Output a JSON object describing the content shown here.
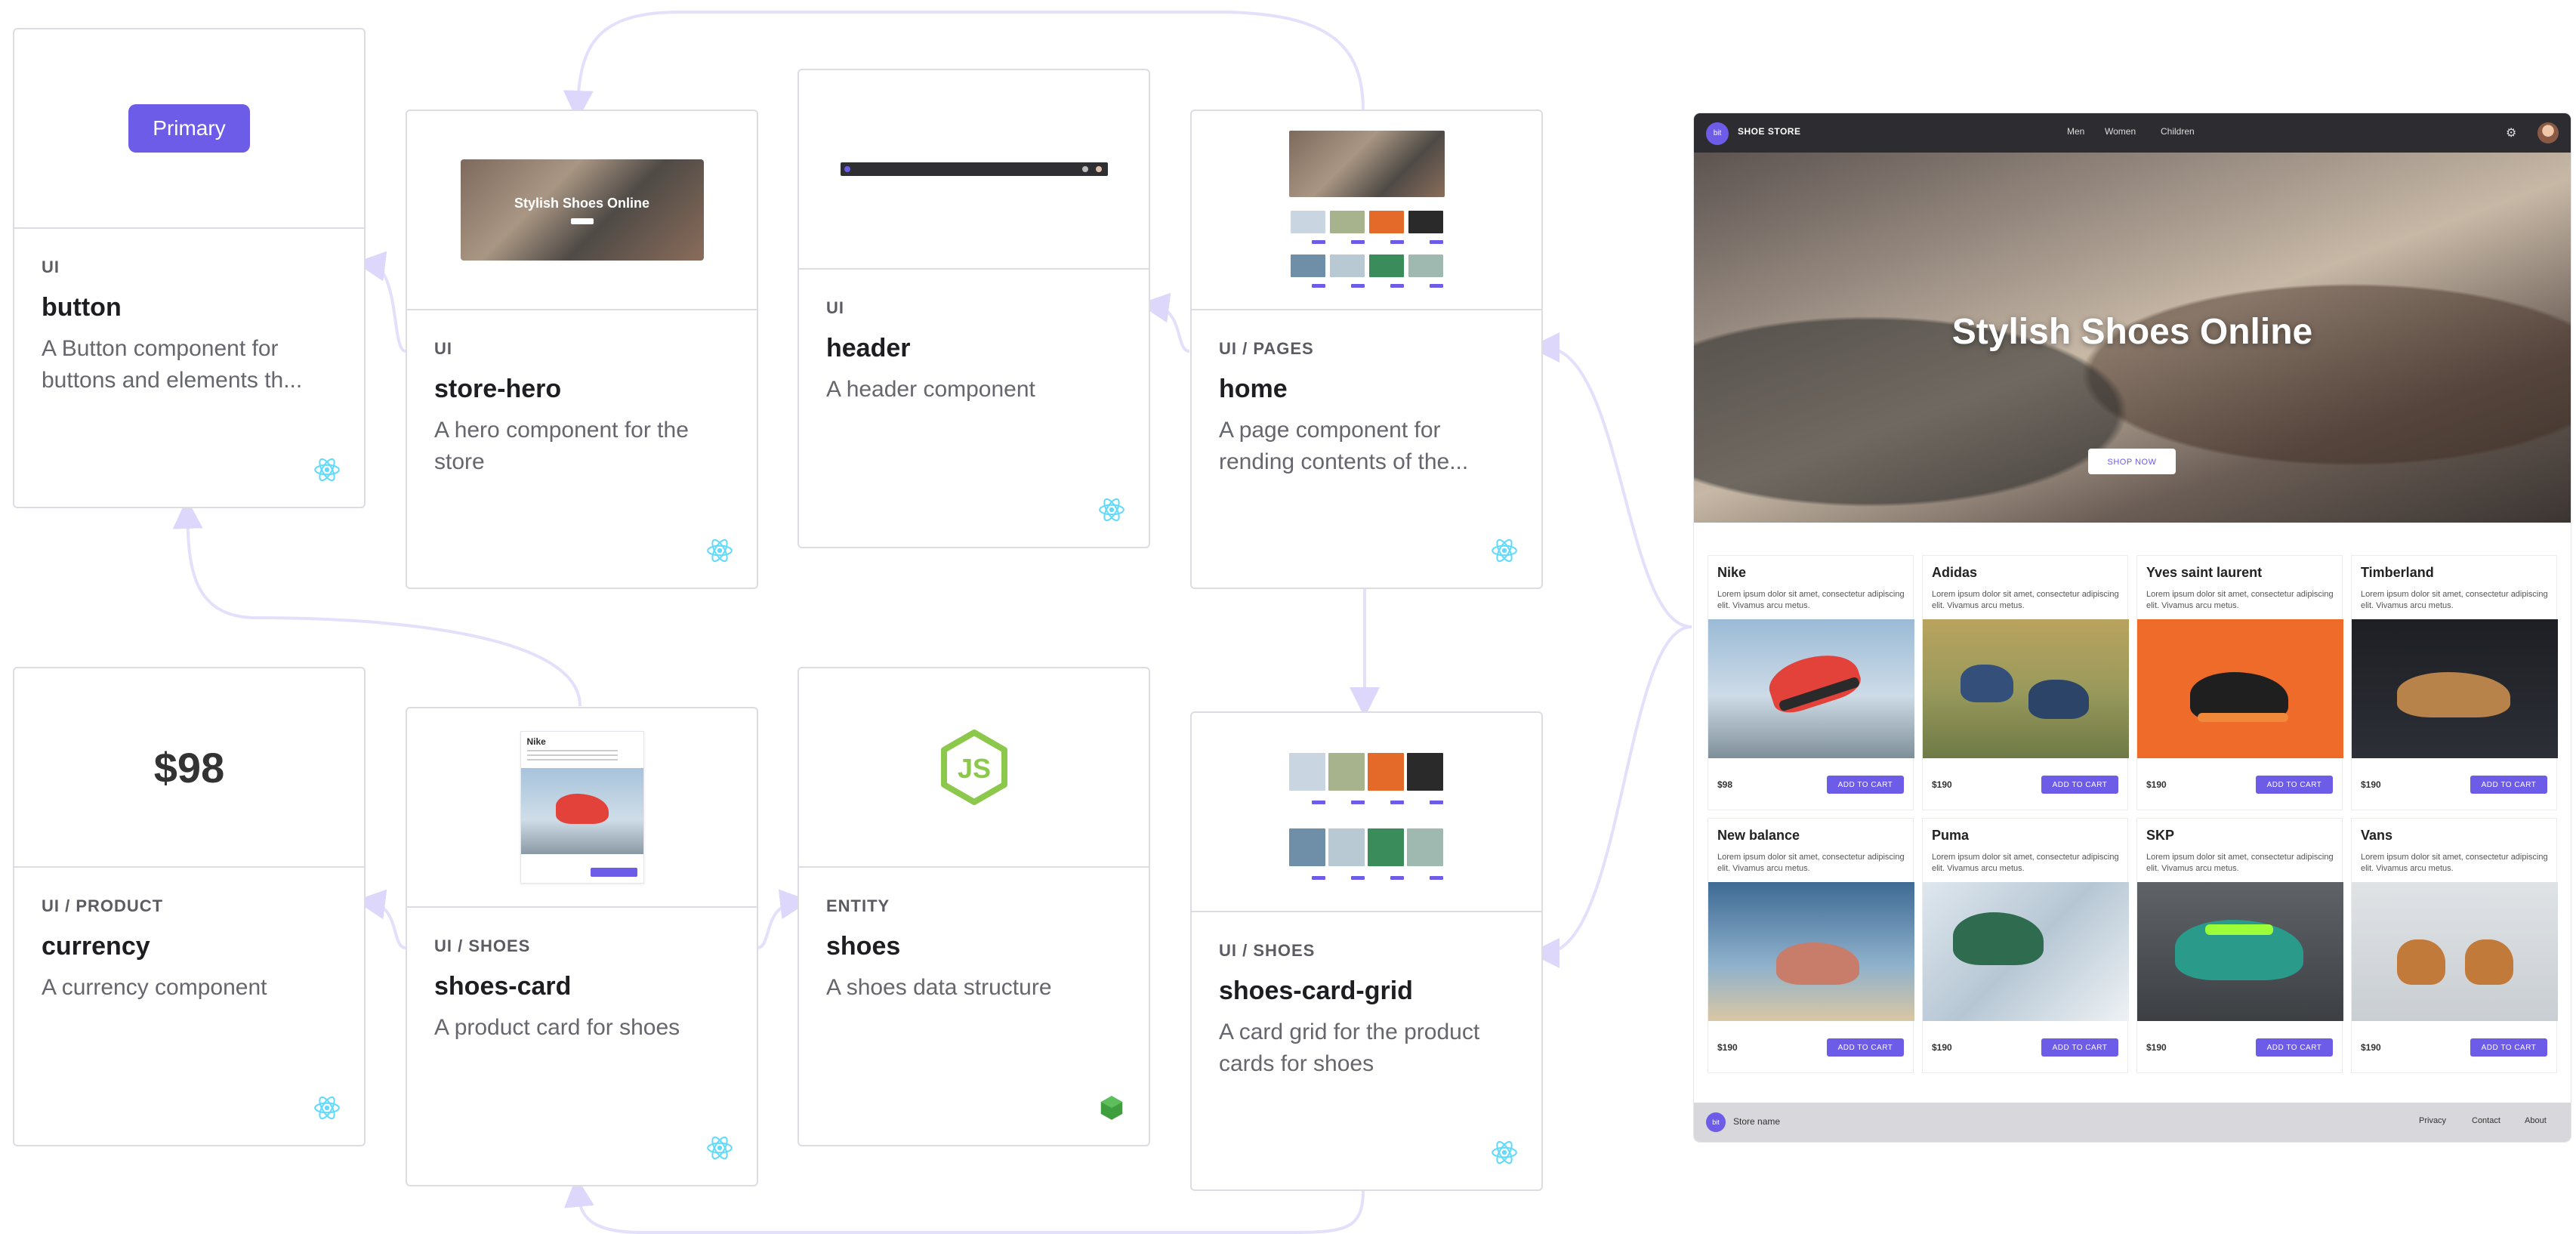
{
  "cards": {
    "button": {
      "category": "UI",
      "name": "button",
      "description": "A Button component for buttons and elements th...",
      "preview_label": "Primary"
    },
    "store_hero": {
      "category": "UI",
      "name": "store-hero",
      "description": "A hero component for the store",
      "preview_title": "Stylish Shoes Online"
    },
    "header": {
      "category": "UI",
      "name": "header",
      "description": "A header component"
    },
    "home": {
      "category": "UI / PAGES",
      "name": "home",
      "description": "A page component for rending contents of the..."
    },
    "currency": {
      "category": "UI / PRODUCT",
      "name": "currency",
      "description": "A currency component",
      "preview_value": "$98"
    },
    "shoes_card": {
      "category": "UI / SHOES",
      "name": "shoes-card",
      "description": "A product card for shoes",
      "preview_title": "Nike"
    },
    "shoes": {
      "category": "ENTITY",
      "name": "shoes",
      "description": "A shoes data structure"
    },
    "shoes_card_grid": {
      "category": "UI / SHOES",
      "name": "shoes-card-grid",
      "description": "A card grid for the product cards for shoes"
    }
  },
  "store": {
    "logo_text": "bit",
    "brand": "SHOE STORE",
    "nav": [
      "Men",
      "Women",
      "Children"
    ],
    "hero_title": "Stylish Shoes Online",
    "hero_button": "SHOP NOW",
    "add_to_cart": "ADD TO CART",
    "products": [
      {
        "name": "Nike",
        "description": "Lorem ipsum dolor sit amet, consectetur adipiscing elit. Vivamus arcu metus.",
        "price": "$98"
      },
      {
        "name": "Adidas",
        "description": "Lorem ipsum dolor sit amet, consectetur adipiscing elit. Vivamus arcu metus.",
        "price": "$190"
      },
      {
        "name": "Yves saint laurent",
        "description": "Lorem ipsum dolor sit amet, consectetur adipiscing elit. Vivamus arcu metus.",
        "price": "$190"
      },
      {
        "name": "Timberland",
        "description": "Lorem ipsum dolor sit amet, consectetur adipiscing elit. Vivamus arcu metus.",
        "price": "$190"
      },
      {
        "name": "New balance",
        "description": "Lorem ipsum dolor sit amet, consectetur adipiscing elit. Vivamus arcu metus.",
        "price": "$190"
      },
      {
        "name": "Puma",
        "description": "Lorem ipsum dolor sit amet, consectetur adipiscing elit. Vivamus arcu metus.",
        "price": "$190"
      },
      {
        "name": "SKP",
        "description": "Lorem ipsum dolor sit amet, consectetur adipiscing elit. Vivamus arcu metus.",
        "price": "$190"
      },
      {
        "name": "Vans",
        "description": "Lorem ipsum dolor sit amet, consectetur adipiscing elit. Vivamus arcu metus.",
        "price": "$190"
      }
    ],
    "footer": {
      "logo_text": "bit",
      "name": "Store name",
      "links": [
        "Privacy",
        "Contact",
        "About"
      ]
    }
  },
  "colors": {
    "accent": "#6c5ce7",
    "card_border": "#dcdce2",
    "connector": "#e3e0fb",
    "react_icon": "#61dafb",
    "node_icon": "#8cc84b",
    "entity_icon": "#3f9f3f"
  }
}
